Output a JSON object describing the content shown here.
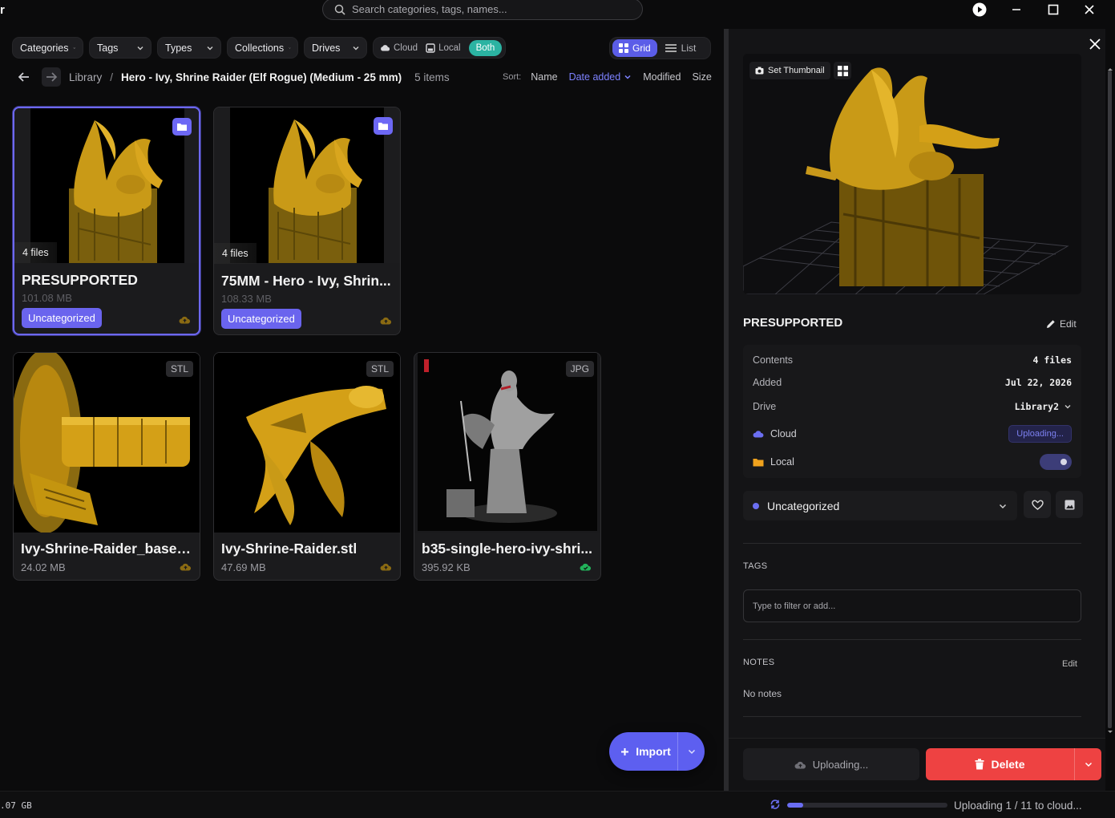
{
  "app": {
    "glyph": "r"
  },
  "search": {
    "placeholder": "Search categories, tags, names..."
  },
  "filters": {
    "categories": "Categories",
    "tags": "Tags",
    "types": "Types",
    "collections": "Collections",
    "drives": "Drives",
    "source": {
      "cloud": "Cloud",
      "local": "Local",
      "both": "Both"
    }
  },
  "view": {
    "grid": "Grid",
    "list": "List"
  },
  "breadcrumb": {
    "root": "Library",
    "separator": "/",
    "current": "Hero - Ivy, Shrine Raider (Elf Rogue) (Medium - 25 mm)",
    "count": "5 items"
  },
  "sort": {
    "label": "Sort:",
    "options": [
      "Name",
      "Date added",
      "Modified",
      "Size"
    ],
    "active": "Date added"
  },
  "cards": [
    {
      "title": "PRESUPPORTED",
      "size": "101.08 MB",
      "files": "4 files",
      "category": "Uncategorized",
      "kind": "folder"
    },
    {
      "title": "75MM - Hero - Ivy, Shrin...",
      "size": "108.33 MB",
      "files": "4 files",
      "category": "Uncategorized",
      "kind": "folder"
    },
    {
      "title": "Ivy-Shrine-Raider_base.stl",
      "size": "24.02 MB",
      "type": "STL"
    },
    {
      "title": "Ivy-Shrine-Raider.stl",
      "size": "47.69 MB",
      "type": "STL"
    },
    {
      "title": "b35-single-hero-ivy-shri...",
      "size": "395.92 KB",
      "type": "JPG"
    }
  ],
  "import": {
    "label": "Import"
  },
  "panel": {
    "set_thumbnail": "Set Thumbnail",
    "title": "PRESUPPORTED",
    "edit": "Edit",
    "meta": {
      "contents_label": "Contents",
      "contents": "4 files",
      "added_label": "Added",
      "added": "Jul 22, 2026",
      "drive_label": "Drive",
      "drive": "Library2",
      "cloud_label": "Cloud",
      "cloud_status": "Uploading...",
      "local_label": "Local"
    },
    "category": "Uncategorized",
    "tags_head": "TAGS",
    "tags_placeholder": "Type to filter or add...",
    "notes_head": "NOTES",
    "notes_edit": "Edit",
    "notes": "No notes",
    "uploading_btn": "Uploading...",
    "delete_btn": "Delete"
  },
  "status": {
    "storage": ".07 GB",
    "upload": "Uploading 1 / 11 to cloud...",
    "progress": 0.1
  },
  "colors": {
    "accent": "#5d5ff0",
    "both": "#2bb3a2",
    "danger": "#ee4242",
    "gold": "#d4a017"
  }
}
